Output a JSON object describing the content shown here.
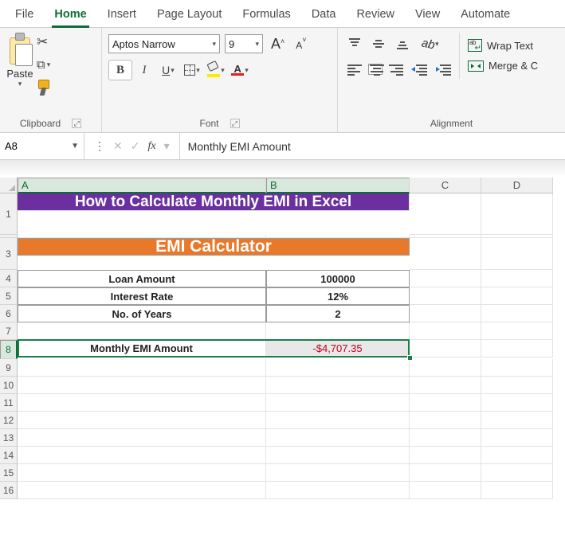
{
  "tabs": [
    "File",
    "Home",
    "Insert",
    "Page Layout",
    "Formulas",
    "Data",
    "Review",
    "View",
    "Automate"
  ],
  "active_tab": 1,
  "ribbon": {
    "clipboard": {
      "paste": "Paste",
      "label": "Clipboard"
    },
    "font": {
      "name": "Aptos Narrow",
      "size": "9",
      "label": "Font"
    },
    "alignment": {
      "wrap": "Wrap Text",
      "merge": "Merge & C",
      "label": "Alignment"
    }
  },
  "namebox": "A8",
  "formula": "Monthly EMI Amount",
  "columns": [
    "A",
    "B",
    "C",
    "D"
  ],
  "selected_cols": [
    "A",
    "B"
  ],
  "selected_row": 8,
  "sheet": {
    "title": "How to Calculate Monthly EMI in Excel",
    "header2": "EMI Calculator",
    "rows": [
      {
        "label": "Loan Amount",
        "value": "100000"
      },
      {
        "label": "Interest Rate",
        "value": "12%"
      },
      {
        "label": "No. of Years",
        "value": "2"
      }
    ],
    "emi_label": "Monthly EMI Amount",
    "emi_value": "-$4,707.35"
  },
  "row_numbers": [
    1,
    3,
    4,
    5,
    6,
    7,
    8,
    9,
    10,
    11,
    12,
    13,
    14,
    15,
    16
  ]
}
